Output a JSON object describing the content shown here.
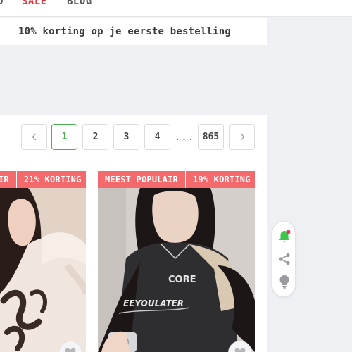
{
  "nav": {
    "partial_item": "O",
    "sale": "SALE",
    "blog": "BLOG"
  },
  "promo": {
    "text": "10% korting op je eerste bestelling"
  },
  "pagination": {
    "prev_icon": "chevron-left-icon",
    "pages": [
      "1",
      "2",
      "3",
      "4"
    ],
    "active_page": "1",
    "ellipsis": "...",
    "last_page": "865",
    "next_icon": "chevron-right-icon"
  },
  "products": [
    {
      "badges": [
        "IR",
        "21% KORTING"
      ]
    },
    {
      "badges": [
        "MEEST POPULAIR",
        "19% KORTING"
      ],
      "print_text": "CORE",
      "print_text_2": "EEYOULATER"
    }
  ],
  "side_tools": {
    "icons": [
      "bell-icon",
      "share-icon",
      "lightbulb-icon"
    ]
  },
  "colors": {
    "sale_red": "#e8333a",
    "badge_bg": "#f4696c",
    "active_green": "#4caf50",
    "bell_green": "#3cc64a",
    "notification_dot": "#e8336a",
    "page_bg": "#eff0f4"
  }
}
